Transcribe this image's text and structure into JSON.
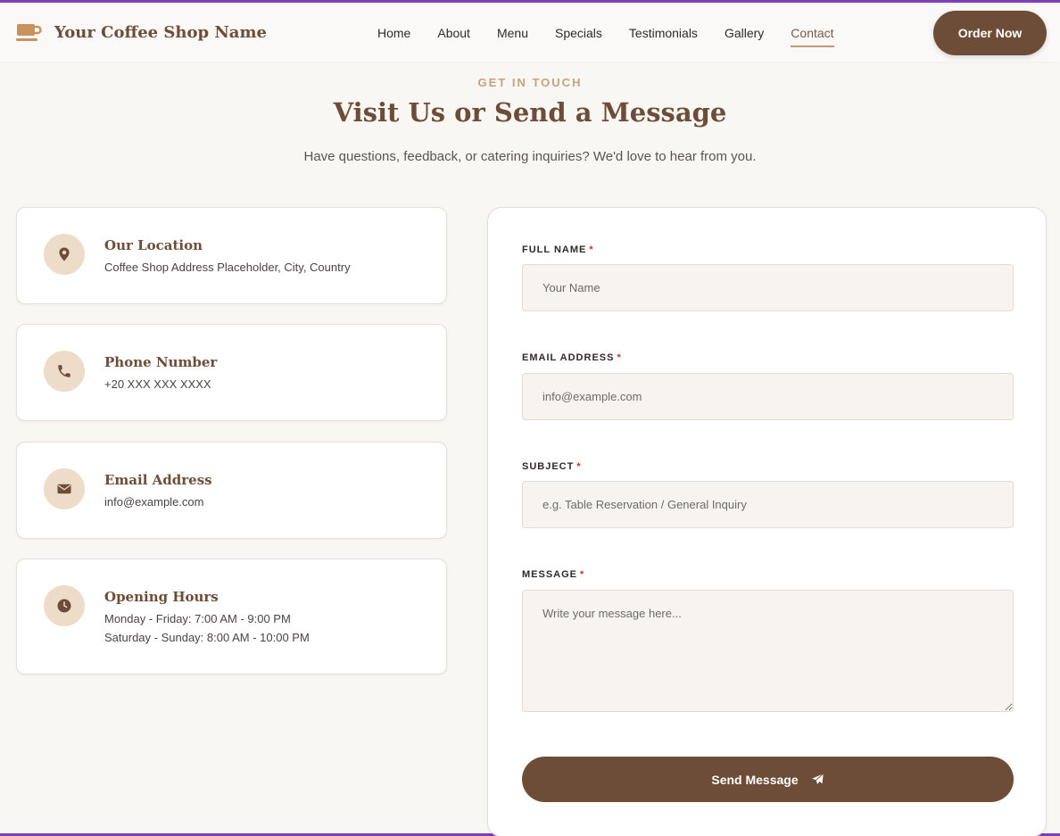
{
  "header": {
    "brand": "Your Coffee Shop Name",
    "nav": [
      "Home",
      "About",
      "Menu",
      "Specials",
      "Testimonials",
      "Gallery",
      "Contact"
    ],
    "active_nav": "Contact",
    "order_button": "Order Now"
  },
  "section": {
    "eyebrow": "GET IN TOUCH",
    "title": "Visit Us or Send a Message",
    "subtitle": "Have questions, feedback, or catering inquiries? We'd love to hear from you."
  },
  "info_cards": [
    {
      "icon": "location-pin-icon",
      "title": "Our Location",
      "lines": [
        "Coffee Shop Address Placeholder, City, Country"
      ]
    },
    {
      "icon": "phone-icon",
      "title": "Phone Number",
      "lines": [
        "+20 XXX XXX XXXX"
      ]
    },
    {
      "icon": "envelope-icon",
      "title": "Email Address",
      "lines": [
        "info@example.com"
      ]
    },
    {
      "icon": "clock-icon",
      "title": "Opening Hours",
      "lines": [
        "Monday - Friday: 7:00 AM - 9:00 PM",
        "Saturday - Sunday: 8:00 AM - 10:00 PM"
      ]
    }
  ],
  "form": {
    "name_label": "FULL NAME",
    "name_placeholder": "Your Name",
    "email_label": "EMAIL ADDRESS",
    "email_placeholder": "info@example.com",
    "subject_label": "SUBJECT",
    "subject_placeholder": "e.g. Table Reservation / General Inquiry",
    "message_label": "MESSAGE",
    "message_placeholder": "Write your message here...",
    "required_mark": "*",
    "submit_label": "Send Message"
  },
  "colors": {
    "brand_brown": "#6e4d38",
    "accent_tan": "#c8a27a",
    "icon_bg": "#ecdcc8",
    "page_bg": "#f9f7f4"
  }
}
